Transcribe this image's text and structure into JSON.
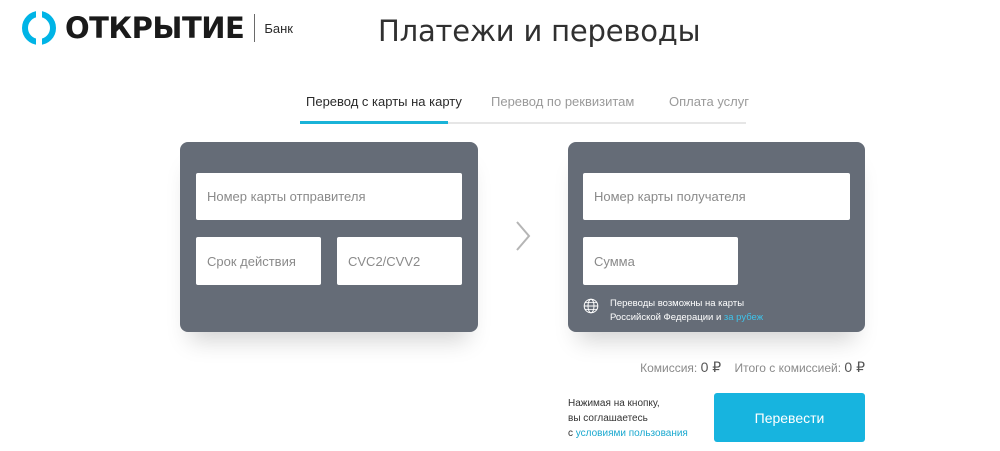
{
  "header": {
    "brand": "ОТКРЫТИЕ",
    "brand_sub": "Банк",
    "title": "Платежи и переводы"
  },
  "tabs": [
    {
      "label": "Перевод с карты на карту",
      "active": true
    },
    {
      "label": "Перевод по реквизитам",
      "active": false
    },
    {
      "label": "Оплата услуг",
      "active": false
    }
  ],
  "sender_card": {
    "card_number_placeholder": "Номер карты отправителя",
    "expiry_placeholder": "Срок действия",
    "cvc_placeholder": "CVC2/CVV2"
  },
  "receiver_card": {
    "card_number_placeholder": "Номер карты получателя",
    "amount_placeholder": "Сумма",
    "info_line1": "Переводы возможны на карты",
    "info_line2": "Российской Федерации и ",
    "info_link": "за рубеж"
  },
  "fees": {
    "commission_label": "Комиссия:",
    "commission_value": "0 ₽",
    "total_label": "Итого с комиссией:",
    "total_value": "0 ₽"
  },
  "agreement": {
    "line1": "Нажимая на кнопку,",
    "line2": "вы соглашаетесь",
    "line3_prefix": "с ",
    "link": "условиями пользования"
  },
  "submit_label": "Перевести",
  "icons": {
    "logo": "otkritie-logo-icon",
    "arrow": "chevron-right-icon",
    "globe": "globe-icon"
  },
  "colors": {
    "accent": "#19b3d8",
    "card_bg": "#656c77",
    "logo": "#00b4e6"
  }
}
